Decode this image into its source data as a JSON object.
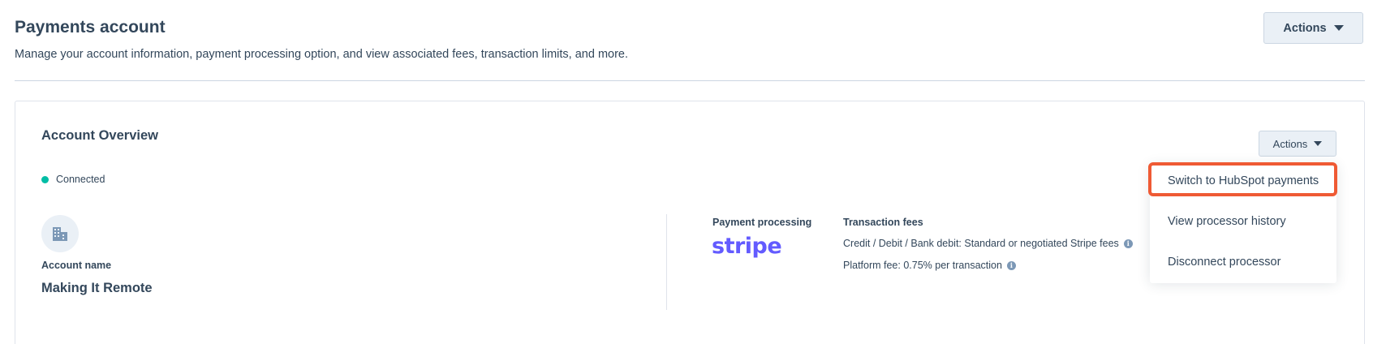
{
  "header": {
    "title": "Payments account",
    "subtitle": "Manage your account information, payment processing option, and view associated fees, transaction limits, and more.",
    "actions_label": "Actions"
  },
  "overview": {
    "title": "Account Overview",
    "actions_label": "Actions",
    "status": "Connected",
    "status_color": "#00bda5",
    "avatar_icon": "building-icon",
    "account_label": "Account name",
    "account_name": "Making It Remote"
  },
  "processing": {
    "label": "Payment processing",
    "logo_text": "stripe",
    "logo_color": "#635bff"
  },
  "fees": {
    "label": "Transaction fees",
    "line1": "Credit / Debit / Bank debit: Standard or negotiated Stripe fees",
    "line2": "Platform fee: 0.75% per transaction",
    "info_icon": "info-icon"
  },
  "dropdown": {
    "items": [
      {
        "label": "Switch to HubSpot payments",
        "highlighted": true
      },
      {
        "label": "View processor history"
      },
      {
        "label": "Disconnect processor"
      }
    ],
    "highlight_color": "#ef5a34"
  }
}
